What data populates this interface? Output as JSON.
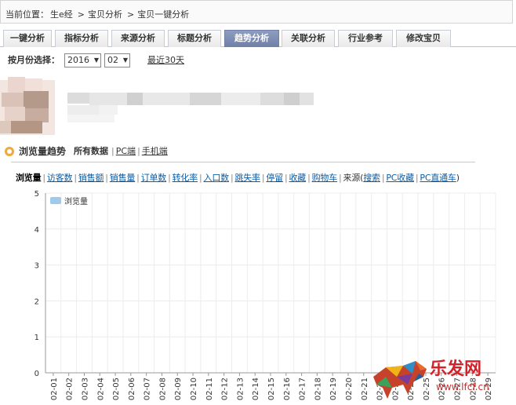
{
  "breadcrumb": {
    "prefix": "当前位置：",
    "items": [
      "生e经",
      "宝贝分析",
      "宝贝一键分析"
    ],
    "sep": ">"
  },
  "tabs": [
    {
      "label": "一键分析",
      "active": false
    },
    {
      "label": "指标分析",
      "active": false
    },
    {
      "label": "来源分析",
      "active": false
    },
    {
      "label": "标题分析",
      "active": false
    },
    {
      "label": "趋势分析",
      "active": true
    },
    {
      "label": "关联分析",
      "active": false
    },
    {
      "label": "行业参考",
      "active": false
    },
    {
      "label": "修改宝贝",
      "active": false
    }
  ],
  "filter": {
    "label": "按月份选择：",
    "year": "2016",
    "month": "02",
    "recent_link": "最近30天"
  },
  "section": {
    "title": "浏览量趋势",
    "filters": [
      {
        "label": "所有数据",
        "active": true
      },
      {
        "label": "PC端",
        "active": false
      },
      {
        "label": "手机端",
        "active": false
      }
    ]
  },
  "metrics": [
    {
      "label": "浏览量",
      "active": true
    },
    {
      "label": "访客数",
      "active": false
    },
    {
      "label": "销售额",
      "active": false
    },
    {
      "label": "销售量",
      "active": false
    },
    {
      "label": "订单数",
      "active": false
    },
    {
      "label": "转化率",
      "active": false
    },
    {
      "label": "入口数",
      "active": false
    },
    {
      "label": "跳失率",
      "active": false
    },
    {
      "label": "停留",
      "active": false
    },
    {
      "label": "收藏",
      "active": false
    },
    {
      "label": "购物车",
      "active": false
    }
  ],
  "source": {
    "prefix": "来源(",
    "items": [
      "搜索",
      "PC收藏",
      "PC直通车"
    ],
    "suffix": ")"
  },
  "colors": {
    "tab_active": "#7686ae",
    "accent_orange": "#f2a93c",
    "link": "#0b5ea8",
    "series": "#9fcbeb"
  },
  "watermark": {
    "brand": "乐发网",
    "url": "www.lfcf.cn"
  },
  "chart_data": {
    "type": "line",
    "x": [
      "02-01",
      "02-02",
      "02-03",
      "02-04",
      "02-05",
      "02-06",
      "02-07",
      "02-08",
      "02-09",
      "02-10",
      "02-11",
      "02-12",
      "02-13",
      "02-14",
      "02-15",
      "02-16",
      "02-17",
      "02-18",
      "02-19",
      "02-20",
      "02-21",
      "02-22",
      "02-23",
      "02-24",
      "02-25",
      "02-26",
      "02-27",
      "02-28",
      "02-29"
    ],
    "series": [
      {
        "name": "浏览量",
        "values": []
      }
    ],
    "ylim": [
      0,
      5
    ],
    "yticks": [
      0,
      1,
      2,
      3,
      4,
      5
    ],
    "grid": true,
    "legend": "top-left",
    "title": "",
    "xlabel": "",
    "ylabel": ""
  }
}
